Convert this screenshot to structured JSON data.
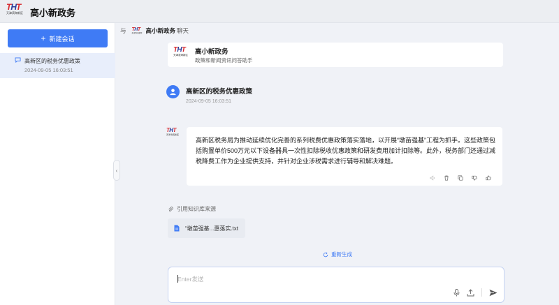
{
  "app": {
    "logo_text": "THT",
    "logo_subtext": "天津滨海新区",
    "title": "高小新政务"
  },
  "sidebar": {
    "new_chat_label": "新建会话",
    "sessions": [
      {
        "title": "高新区的税务优惠政策",
        "time": "2024-09-05 16:03:51"
      }
    ]
  },
  "chat_header": {
    "with_label": "与",
    "bot_name": "高小新政务",
    "suffix": "聊天"
  },
  "bot_card": {
    "name": "高小新政务",
    "description": "政策和新闻资讯问答助手"
  },
  "user_message": {
    "text": "高新区的税务优惠政策",
    "time": "2024-09-05 16:03:51"
  },
  "answer": {
    "text": "高新区税务局为推动延续优化完善的系列税费优惠政策落实落地，以开展“墩苗强基”工程为抓手。这些政策包括购置单价500万元以下设备器具一次性扣除税收优惠政策和研发费用加计扣除等。此外，税务部门还通过减税降费工作为企业提供支持，并针对企业涉税需求进行辅导和解决难题。",
    "tool_icons": [
      "speaker-icon",
      "delete-icon",
      "copy-icon",
      "dislike-icon",
      "like-icon"
    ]
  },
  "knowledge": {
    "label": "引用知识库来源",
    "files": [
      {
        "name": "“墩苗强基...惠落实.txt"
      }
    ]
  },
  "regenerate_label": "重新生成",
  "composer": {
    "placeholder": "Enter发送"
  },
  "colors": {
    "accent": "#3f7bf5",
    "logo_red": "#d6262b",
    "logo_blue": "#2a3e9c"
  }
}
